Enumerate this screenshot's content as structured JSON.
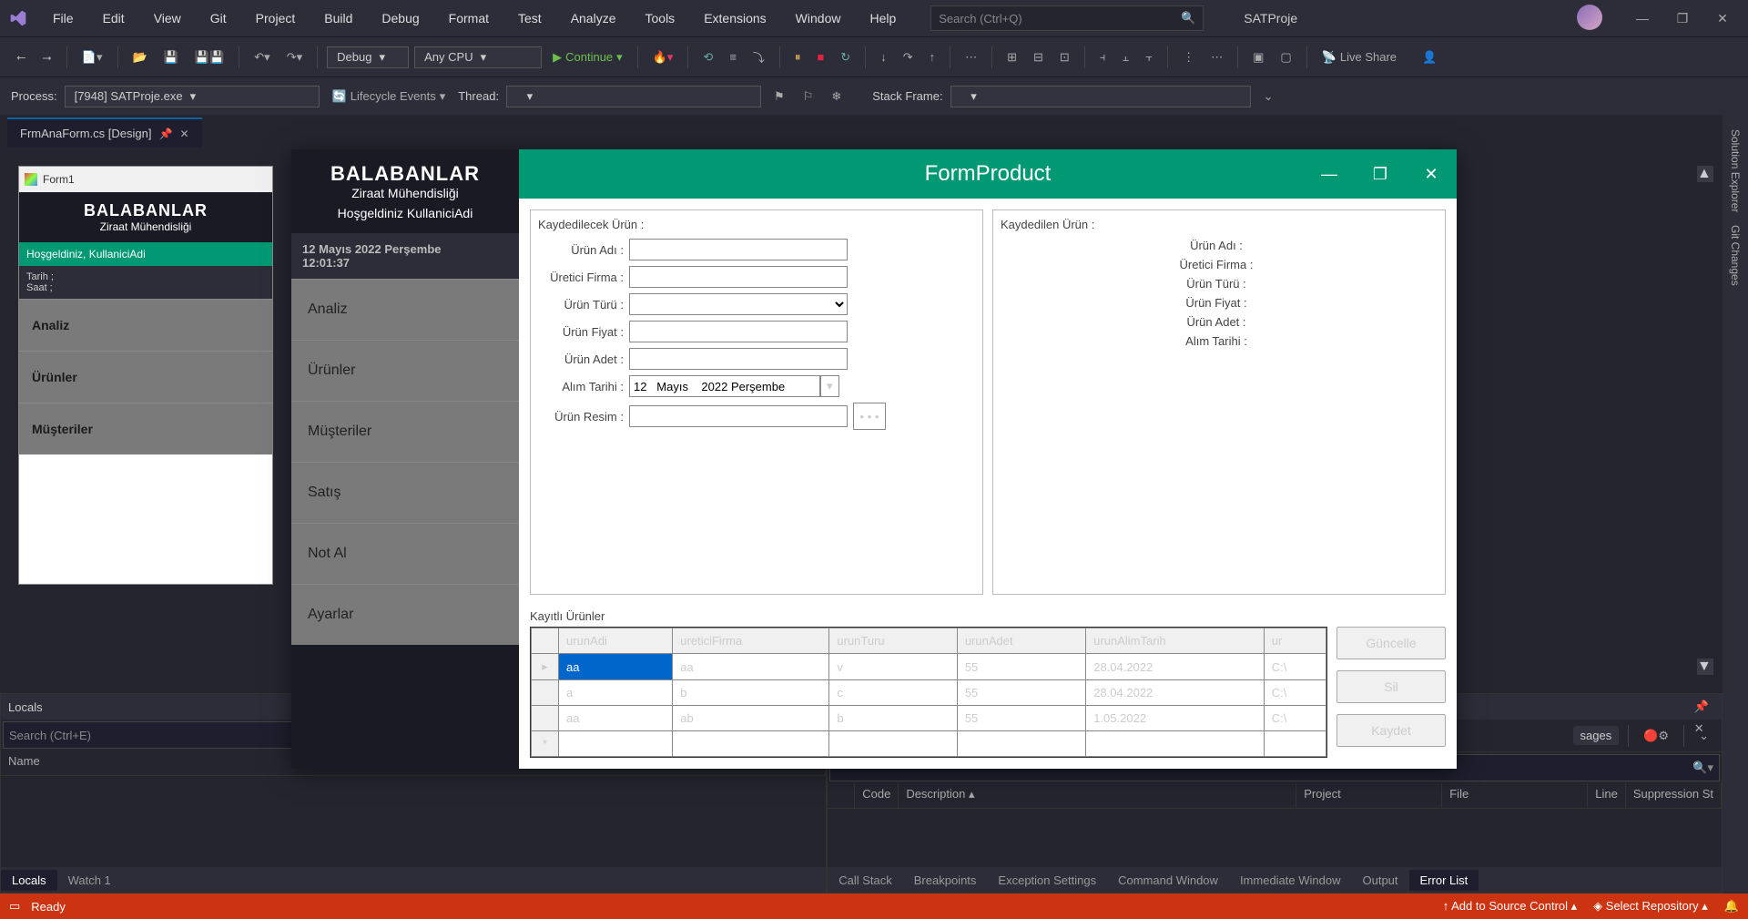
{
  "menu": [
    "File",
    "Edit",
    "View",
    "Git",
    "Project",
    "Build",
    "Debug",
    "Format",
    "Test",
    "Analyze",
    "Tools",
    "Extensions",
    "Window",
    "Help"
  ],
  "search_placeholder": "Search (Ctrl+Q)",
  "solution_name": "SATProje",
  "toolbar": {
    "config": "Debug",
    "platform": "Any CPU",
    "continue_label": "Continue",
    "liveshare": "Live Share"
  },
  "debugbar": {
    "process_label": "Process:",
    "process_value": "[7948] SATProje.exe",
    "lifecycle": "Lifecycle Events",
    "thread_label": "Thread:",
    "stackframe_label": "Stack Frame:"
  },
  "doc_tab": "FrmAnaForm.cs [Design]",
  "form_preview": {
    "caption": "Form1",
    "title": "BALABANLAR",
    "subtitle": "Ziraat Mühendisliği",
    "welcome": "Hoşgeldiniz, KullaniciAdi",
    "date_label": "Tarih ;",
    "time_label": "Saat ;",
    "items": [
      "Analiz",
      "Ürünler",
      "Müşteriler"
    ]
  },
  "app": {
    "sidebar": {
      "title": "BALABANLAR",
      "subtitle": "Ziraat Mühendisliği",
      "welcome": "Hoşgeldiniz KullaniciAdi",
      "date": "12 Mayıs 2022 Perşembe",
      "time": "12:01:37",
      "items": [
        "Analiz",
        "Ürünler",
        "Müşteriler",
        "Satış",
        "Not Al",
        "Ayarlar"
      ]
    },
    "title": "FormProduct",
    "left": {
      "group": "Kaydedilecek Ürün :",
      "name": "Ürün Adı :",
      "firm": "Üretici Firma :",
      "type": "Ürün Türü :",
      "price": "Ürün Fiyat :",
      "qty": "Ürün Adet :",
      "date": "Alım Tarihi :",
      "date_value": "12   Mayıs    2022 Perşembe",
      "img": "Ürün Resim :"
    },
    "right": {
      "group": "Kaydedilen Ürün :",
      "name": "Ürün Adı :",
      "firm": "Üretici Firma :",
      "type": "Ürün Türü :",
      "price": "Ürün Fiyat :",
      "qty": "Ürün Adet :",
      "date": "Alım Tarihi :"
    },
    "grid_title": "Kayıtlı Ürünler",
    "cols": [
      "urunAdi",
      "ureticiFirma",
      "urunTuru",
      "urunAdet",
      "urunAlimTarih",
      "ur"
    ],
    "rows": [
      {
        "a": "aa",
        "b": "aa",
        "c": "v",
        "d": "55",
        "e": "28.04.2022",
        "f": "C:\\"
      },
      {
        "a": "a",
        "b": "b",
        "c": "c",
        "d": "55",
        "e": "28.04.2022",
        "f": "C:\\"
      },
      {
        "a": "aa",
        "b": "ab",
        "c": "b",
        "d": "55",
        "e": "1.05.2022",
        "f": "C:\\"
      }
    ],
    "btns": {
      "update": "Güncelle",
      "delete": "Sil",
      "save": "Kaydet"
    }
  },
  "locals": {
    "title": "Locals",
    "search": "Search (Ctrl+E)",
    "col_name": "Name",
    "tabs": [
      "Locals",
      "Watch 1"
    ]
  },
  "errorlist": {
    "messages_btn": "sages",
    "col_code": "Code",
    "col_desc": "Description",
    "col_project": "Project",
    "col_file": "File",
    "col_line": "Line",
    "col_supp": "Suppression St",
    "tabs": [
      "Call Stack",
      "Breakpoints",
      "Exception Settings",
      "Command Window",
      "Immediate Window",
      "Output",
      "Error List"
    ]
  },
  "right_dock": [
    "Solution Explorer",
    "Git Changes"
  ],
  "status": {
    "ready": "Ready",
    "add_src": "Add to Source Control",
    "select_repo": "Select Repository"
  }
}
